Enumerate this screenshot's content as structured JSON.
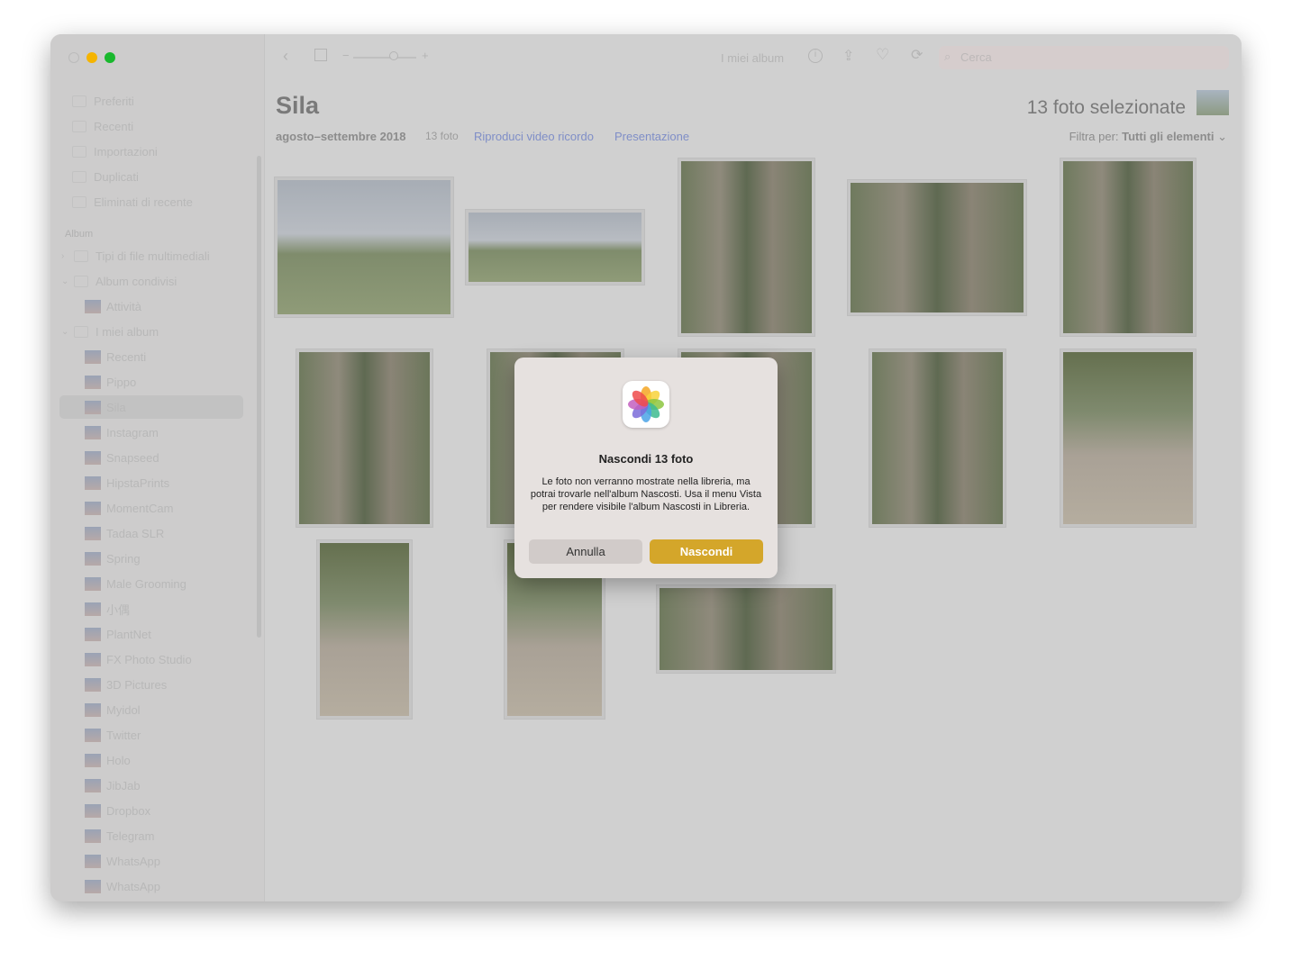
{
  "window": {
    "traffic_lights": {
      "close": "#d8d8d8",
      "minimize": "#f5b400",
      "zoom": "#19b82d"
    }
  },
  "sidebar": {
    "library_items": [
      {
        "label": "Preferiti",
        "icon": "heart-icon"
      },
      {
        "label": "Recenti",
        "icon": "clock-icon"
      },
      {
        "label": "Importazioni",
        "icon": "import-icon"
      },
      {
        "label": "Duplicati",
        "icon": "duplicate-icon"
      },
      {
        "label": "Eliminati di recente",
        "icon": "trash-icon"
      }
    ],
    "album_section": "Album",
    "album_items": [
      {
        "label": "Tipi di file multimediali",
        "level": 0,
        "chevron": ">"
      },
      {
        "label": "Album condivisi",
        "level": 0,
        "chevron": "v"
      },
      {
        "label": "Attività",
        "level": 1
      },
      {
        "label": "I miei album",
        "level": 0,
        "chevron": "v"
      },
      {
        "label": "Recenti",
        "level": 1
      },
      {
        "label": "Pippo",
        "level": 1
      },
      {
        "label": "Sila",
        "level": 1,
        "selected": true
      },
      {
        "label": "Instagram",
        "level": 1
      },
      {
        "label": "Snapseed",
        "level": 1
      },
      {
        "label": "HipstaPrints",
        "level": 1
      },
      {
        "label": "MomentCam",
        "level": 1
      },
      {
        "label": "Tadaa SLR",
        "level": 1
      },
      {
        "label": "Spring",
        "level": 1
      },
      {
        "label": "Male Grooming",
        "level": 1
      },
      {
        "label": "小偶",
        "level": 1
      },
      {
        "label": "PlantNet",
        "level": 1
      },
      {
        "label": "FX Photo Studio",
        "level": 1
      },
      {
        "label": "3D Pictures",
        "level": 1
      },
      {
        "label": "Myidol",
        "level": 1
      },
      {
        "label": "Twitter",
        "level": 1
      },
      {
        "label": "Holo",
        "level": 1
      },
      {
        "label": "JibJab",
        "level": 1
      },
      {
        "label": "Dropbox",
        "level": 1
      },
      {
        "label": "Telegram",
        "level": 1
      },
      {
        "label": "WhatsApp",
        "level": 1
      },
      {
        "label": "WhatsApp",
        "level": 1
      }
    ]
  },
  "toolbar": {
    "breadcrumb": "I miei album",
    "search_placeholder": "Cerca",
    "zoom_minus": "−",
    "zoom_plus": "+",
    "zoom_level": 0.5
  },
  "header": {
    "title": "Sila",
    "date_range": "agosto–settembre 2018",
    "count": "13 foto",
    "memory_link": "Riproduci video ricordo",
    "slideshow_link": "Presentazione",
    "selected": "13 foto selezionate",
    "filter_label": "Filtra per:",
    "filter_value": "Tutti gli elementi"
  },
  "dialog": {
    "title": "Nascondi 13 foto",
    "message": "Le foto non verranno mostrate nella libreria, ma potrai trovarle nell'album Nascosti. Usa il menu Vista per rendere visibile l'album Nascosti in Libreria.",
    "cancel": "Annulla",
    "confirm": "Nascondi"
  },
  "colors": {
    "accent": "#7f8ec7",
    "confirm": "#d4a62a"
  }
}
